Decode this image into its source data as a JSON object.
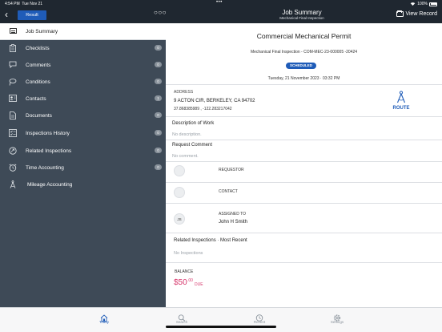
{
  "status_bar": {
    "time": "4:54 PM",
    "date": "Tue Nov 21",
    "battery": "100%"
  },
  "header": {
    "result_label": "Result",
    "title": "Job Summary",
    "subtitle": "Mechanical Final Inspection",
    "view_record_label": "View Record"
  },
  "sidebar": {
    "top_item": {
      "label": "Job Summary",
      "icon": "list-icon"
    },
    "items": [
      {
        "label": "Checklists",
        "count": "0",
        "icon": "clipboard-icon"
      },
      {
        "label": "Comments",
        "count": "0",
        "icon": "comment-icon"
      },
      {
        "label": "Conditions",
        "count": "0",
        "icon": "flag-icon"
      },
      {
        "label": "Contacts",
        "count": "1",
        "icon": "contact-card-icon"
      },
      {
        "label": "Documents",
        "count": "0",
        "icon": "document-icon"
      },
      {
        "label": "Inspections History",
        "count": "0",
        "icon": "checklist-icon"
      },
      {
        "label": "Related Inspections",
        "count": "0",
        "icon": "related-icon"
      },
      {
        "label": "Time Accounting",
        "count": "0",
        "icon": "alarm-clock-icon"
      },
      {
        "label": "Mileage Accounting",
        "count": "",
        "icon": "compass-icon"
      }
    ]
  },
  "main": {
    "permit_title": "Commercial Mechanical Permit",
    "permit_subtitle": "Mechanical Final Inspection - COM-MEC-23-000005 -20424",
    "status_badge": "SCHEDULED",
    "date": "Tuesday, 21 November 2023 · 03:32 PM",
    "address_label": "ADDRESS",
    "address_line": "9 ACTON CIR, BERKELEY, CA 94702",
    "coordinates": "37.868385989 , -122.283217042",
    "route_label": "ROUTE",
    "description_heading": "Description of Work",
    "description_value": "No description.",
    "request_comment_heading": "Request Comment",
    "request_comment_value": "No comment.",
    "requestor_label": "REQUESTOR",
    "contact_label": "CONTACT",
    "assigned_initials": "JS",
    "assigned_label": "ASSIGNED TO",
    "assigned_name": "John H Smith",
    "related_heading": "Related Inspections · Most Recent",
    "related_value": "No Inspections",
    "balance_label": "BALANCE",
    "balance_amount": "$50",
    "balance_cents": ".00",
    "balance_due": "DUE",
    "accent_color": "#1f5cb8",
    "balance_color": "#d6366b"
  },
  "tabbar": {
    "tabs": [
      {
        "label": "Today",
        "icon": "home-icon",
        "active": true
      },
      {
        "label": "Search",
        "icon": "search-icon",
        "active": false
      },
      {
        "label": "Recent",
        "icon": "clock-icon",
        "active": false
      },
      {
        "label": "Settings",
        "icon": "gear-icon",
        "active": false
      }
    ]
  }
}
